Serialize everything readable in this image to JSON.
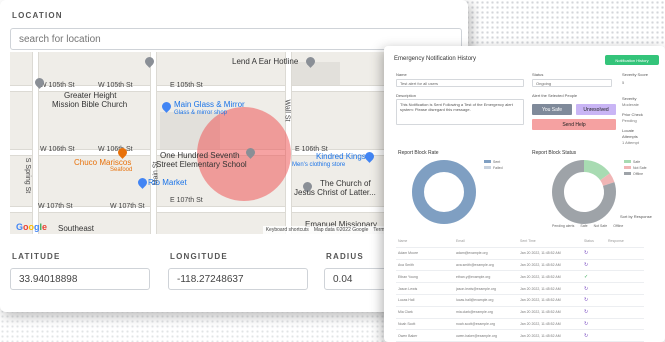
{
  "location_form": {
    "location_label": "LOCATION",
    "search_placeholder": "search for location",
    "latitude_label": "LATITUDE",
    "latitude_value": "33.94018898",
    "longitude_label": "LONGITUDE",
    "longitude_value": "-118.27248637",
    "radius_label": "RADIUS",
    "radius_value": "0.04"
  },
  "map": {
    "places": {
      "lend_a_ear": "Lend A Ear Hotline",
      "greater_height": "Greater Height",
      "mission_bible": "Mission Bible Church",
      "main_glass": "Main Glass & Mirror",
      "glass_sub": "Glass & mirror shop",
      "chuco": "Chuco Mariscos",
      "chuco_sub": "Seafood",
      "one_hundred": "One Hundred Seventh",
      "elementary": "Street Elementary School",
      "rio_market": "Rio Market",
      "kindred": "Kindred Kings",
      "kindred_sub": "Men's clothing store",
      "church_of": "The Church of",
      "jesus_christ": "Jesus Christ of Latter...",
      "southeast": "Southeast",
      "emmanuel": "Emanuel Missionary"
    },
    "streets": {
      "w105_a": "W 105th St",
      "w105_b": "W 105th St",
      "e105": "E 105th St",
      "w106_a": "W 106th St",
      "w106_b": "W 106th St",
      "e106": "E 106th St",
      "w107_a": "W 107th St",
      "w107_b": "W 107th St",
      "e107": "E 107th St",
      "main_st": "Main St",
      "spring_st": "S Spring St",
      "wall_st": "Wall St"
    },
    "footer": {
      "shortcuts": "Keyboard shortcuts",
      "map_data": "Map data ©2022 Google",
      "terms": "Terms"
    },
    "google_letters": [
      "G",
      "o",
      "o",
      "g",
      "l",
      "e"
    ]
  },
  "notification_panel": {
    "title": "Emergency Notification History",
    "top_button": "Notification History",
    "labels": {
      "name": "Name",
      "status": "Status",
      "severity": "Severity Score",
      "description": "Description",
      "action": "Alert the Selected People",
      "severity_side": "Severity",
      "prior": "Prior Check",
      "locate": "Locate",
      "attempts": "Attempts"
    },
    "values": {
      "name": "Test alert for all users",
      "status": "Ongoing",
      "severity_score": "5",
      "description": "This Notification is Sent Following a Test of the Emergency alert system: Please disregard this message.",
      "severity_side": "Moderate",
      "prior": "Pending",
      "attempts": "1 Attempt"
    },
    "buttons": {
      "safe": "You Safe",
      "unsafe": "Unresolved",
      "send": "Send Help"
    },
    "table_header": [
      "Name",
      "Email",
      "Sent Time",
      "Status",
      "Response"
    ],
    "table_rows": [
      [
        "Adam Moore",
        "adam@example.org",
        "Jan 20 2022, 11:45:52 AM",
        "↻"
      ],
      [
        "Ava Smith",
        "ava.smith@example.org",
        "Jan 20 2022, 11:45:52 AM",
        "↻"
      ],
      [
        "Ethan Young",
        "ethan.y@example.org",
        "Jan 20 2022, 11:45:52 AM",
        "✓"
      ],
      [
        "Jason Lewis",
        "jason.lewis@example.org",
        "Jan 20 2022, 11:45:52 AM",
        "↻"
      ],
      [
        "Lucas Hall",
        "lucas.hall@example.org",
        "Jan 20 2022, 11:45:52 AM",
        "↻"
      ],
      [
        "Mia Clark",
        "mia.clark@example.org",
        "Jan 20 2022, 11:45:52 AM",
        "↻"
      ],
      [
        "Noah Scott",
        "noah.scott@example.org",
        "Jan 20 2022, 11:45:52 AM",
        "↻"
      ],
      [
        "Owen Baker",
        "owen.baker@example.org",
        "Jan 20 2022, 11:45:52 AM",
        "↻"
      ]
    ],
    "legend_row": "Sort by Response",
    "filter_chips": [
      "Pending alerts",
      "Safe",
      "Not Safe",
      "Offline"
    ]
  },
  "chart_data": [
    {
      "type": "pie",
      "title": "Report Block Rate",
      "labels": [
        "Sent",
        "Failed"
      ],
      "values": [
        100,
        0
      ],
      "colors": [
        "#7f9fc2",
        "#c8d2de"
      ]
    },
    {
      "type": "pie",
      "title": "Report Block Status",
      "labels": [
        "Safe",
        "Not Safe",
        "Offline"
      ],
      "values": [
        15,
        5,
        80
      ],
      "colors": [
        "#a8dbb2",
        "#f0b5b5",
        "#9ea3a8"
      ]
    }
  ],
  "colors": {
    "radius_circle": "#ee5858",
    "green_button": "#34c47a",
    "purple_button": "#c9b5f5",
    "red_button": "#f5a1a1",
    "grey_button": "#7f8a9a"
  }
}
